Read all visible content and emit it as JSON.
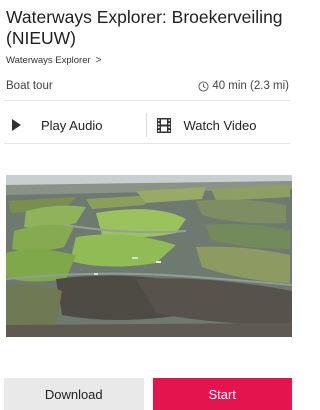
{
  "header": {
    "title": "Waterways Explorer: Broekerveiling (NIEUW)",
    "breadcrumb": "Waterways Explorer",
    "breadcrumb_chevron": ">"
  },
  "meta": {
    "type": "Boat tour",
    "duration": "40 min (2.3 mi)"
  },
  "media": {
    "play_audio": "Play Audio",
    "watch_video": "Watch Video"
  },
  "actions": {
    "download": "Download",
    "start": "Start"
  },
  "colors": {
    "accent": "#e4144f",
    "secondary_button": "#e9e9e9"
  },
  "icons": [
    "chevron-right-icon",
    "clock-icon",
    "play-icon",
    "film-icon"
  ]
}
